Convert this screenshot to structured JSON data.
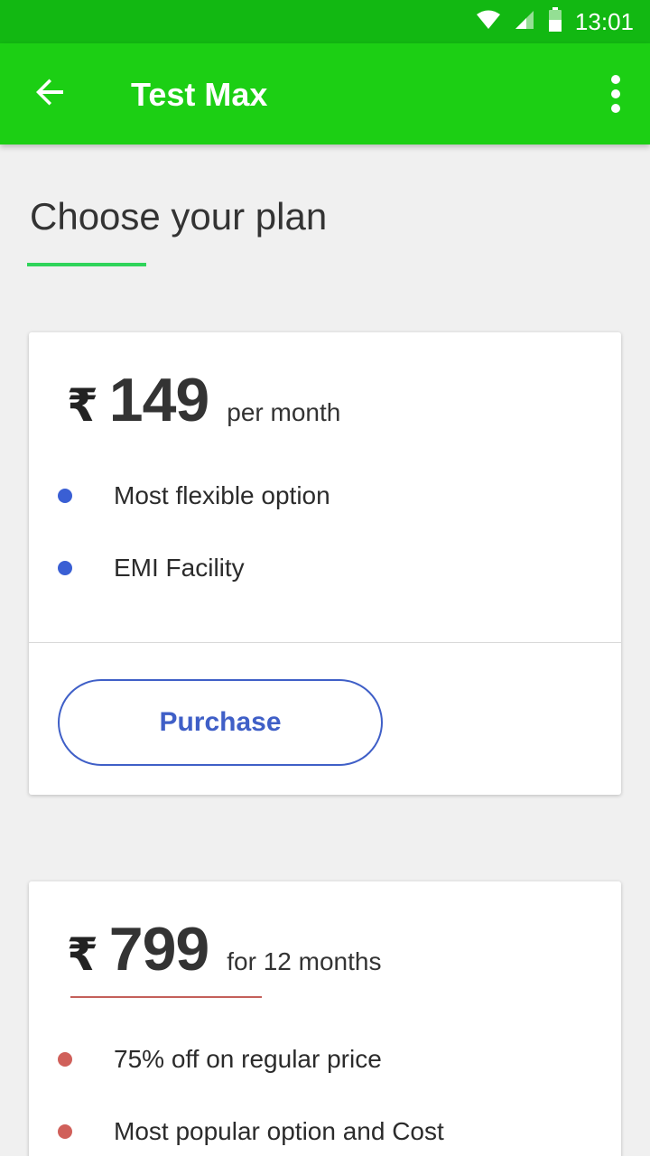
{
  "status_bar": {
    "time": "13:01",
    "icons": [
      "wifi-icon",
      "signal-icon",
      "battery-icon"
    ]
  },
  "app_bar": {
    "title": "Test Max",
    "back_icon": "arrow-left-icon",
    "menu_icon": "more-vert-icon"
  },
  "page": {
    "heading": "Choose your plan"
  },
  "plans": [
    {
      "currency": "₹",
      "price": "149",
      "period": "per month",
      "features": [
        "Most flexible option",
        "EMI Facility"
      ],
      "button_label": "Purchase"
    },
    {
      "currency": "₹",
      "price": "799",
      "period": "for 12 months",
      "features": [
        "75% off on regular price",
        "Most popular option and Cost"
      ]
    }
  ],
  "colors": {
    "status_bar": "#12b812",
    "app_bar": "#1ccf14",
    "accent_blue": "#3f5fc7",
    "accent_red": "#d0605a",
    "heading_underline": "#2fd45a"
  }
}
